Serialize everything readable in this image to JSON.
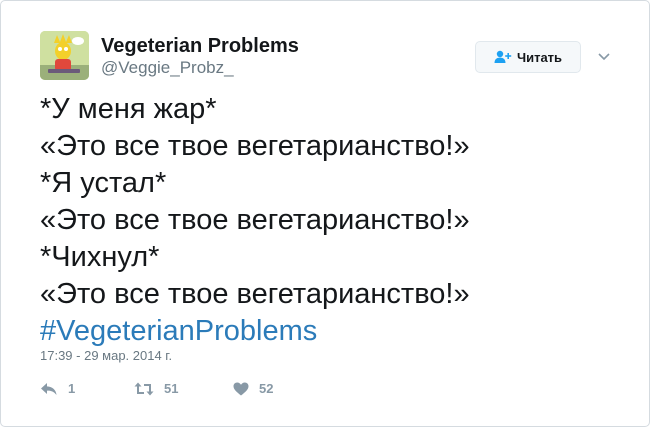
{
  "author": {
    "name": "Vegeterian Problems",
    "handle": "@Veggie_Probz_",
    "avatar_icon": "cartoon-character-avatar"
  },
  "follow_button": {
    "label": "Читать",
    "icon": "add-user-icon"
  },
  "menu_icon": "chevron-down-icon",
  "tweet": {
    "lines": [
      "*У меня жар*",
      "«Это все твое вегетарианство!»",
      "*Я устал*",
      "«Это все твое вегетарианство!»",
      "*Чихнул*",
      "«Это все твое вегетарианство!»"
    ],
    "hashtag": "#VegeterianProblems"
  },
  "timestamp": "17:39 - 29 мар. 2014 г.",
  "actions": {
    "reply_count": "1",
    "retweet_count": "51",
    "like_count": "52"
  },
  "colors": {
    "link": "#2b7bb9",
    "muted": "#697882",
    "action_gray": "#8899a6",
    "border": "#d5dbe0"
  }
}
